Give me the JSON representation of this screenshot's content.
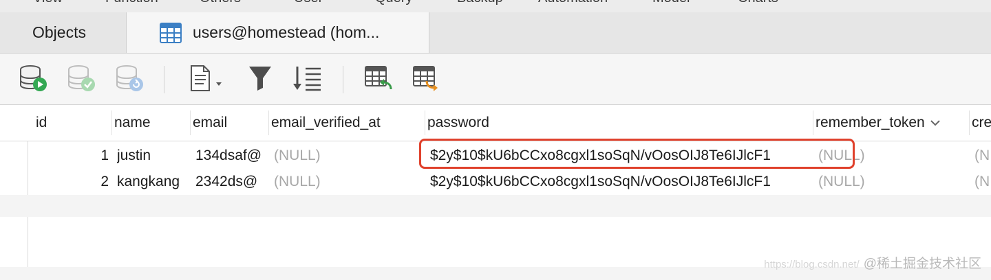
{
  "menu": {
    "items": [
      "View",
      "Function",
      "Others",
      "User",
      "Query",
      "Backup",
      "Automation",
      "Model",
      "Charts"
    ]
  },
  "tabs": {
    "objects_label": "Objects",
    "users_label": "users@homestead (hom..."
  },
  "toolbar": {
    "icons": [
      "db-run-icon",
      "db-commit-icon",
      "db-refresh-icon",
      "text-document-icon",
      "filter-icon",
      "sort-icon",
      "import-table-icon",
      "export-table-icon"
    ]
  },
  "grid": {
    "columns": [
      "id",
      "name",
      "email",
      "email_verified_at",
      "password",
      "remember_token",
      "cre"
    ],
    "rows": [
      {
        "id": "1",
        "name": "justin",
        "email": "134dsaf@",
        "email_verified_at": "(NULL)",
        "password": "$2y$10$kU6bCCxo8cgxl1soSqN/vOosOIJ8Te6IJlcF1",
        "remember_token": "(NULL)",
        "cre": "(N"
      },
      {
        "id": "2",
        "name": "kangkang",
        "email": "2342ds@",
        "email_verified_at": "(NULL)",
        "password": "$2y$10$kU6bCCxo8cgxl1soSqN/vOosOIJ8Te6IJlcF1",
        "remember_token": "(NULL)",
        "cre": "(N"
      }
    ]
  },
  "colors": {
    "highlight": "#e0412c",
    "null_text": "#a8a8a8"
  },
  "watermark": {
    "url": "https://blog.csdn.net/",
    "text": "@稀土掘金技术社区"
  }
}
